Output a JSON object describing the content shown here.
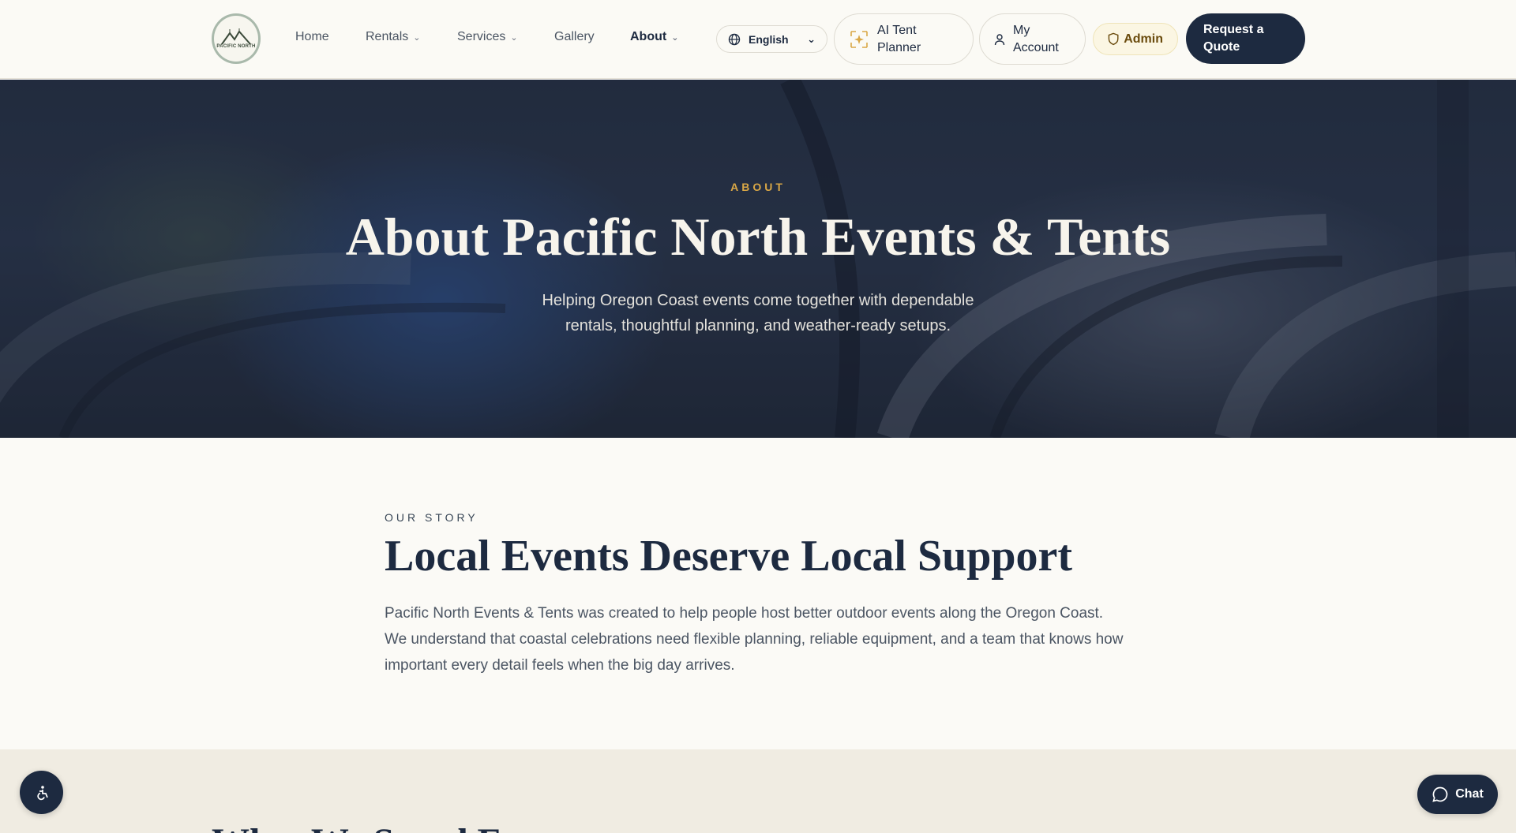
{
  "nav": {
    "logo_text": "PACIFIC NORTH",
    "links": [
      {
        "label": "Home"
      },
      {
        "label": "Rentals"
      },
      {
        "label": "Services"
      },
      {
        "label": "Gallery"
      },
      {
        "label": "About"
      }
    ],
    "language": "English",
    "ai_planner": "AI Tent Planner",
    "ai_planner_line1": "AI Tent",
    "ai_planner_line2": "Planner",
    "account_line1": "My",
    "account_line2": "Account",
    "admin": "Admin",
    "quote_line1": "Request a",
    "quote_line2": "Quote"
  },
  "hero": {
    "eyebrow": "ABOUT",
    "title": "About Pacific North Events & Tents",
    "subtitle": "Helping Oregon Coast events come together with dependable rentals, thoughtful planning, and weather-ready setups."
  },
  "story": {
    "eyebrow": "OUR STORY",
    "title": "Local Events Deserve Local Support",
    "body": "Pacific North Events & Tents was created to help people host better outdoor events along the Oregon Coast. We understand that coastal celebrations need flexible planning, reliable equipment, and a team that knows how important every detail feels when the big day arrives."
  },
  "values": {
    "title": "What We Stand For"
  },
  "chat": {
    "label": "Chat"
  },
  "colors": {
    "navy": "#1d2a40",
    "gold": "#d9a746",
    "cream": "#fbfaf6",
    "sand": "#f0ece2"
  },
  "icons": [
    "logo-mountain-icon",
    "chevron-down-icon",
    "globe-icon",
    "sparkle-icon",
    "user-icon",
    "shield-icon",
    "accessibility-icon",
    "chat-bubble-icon"
  ]
}
